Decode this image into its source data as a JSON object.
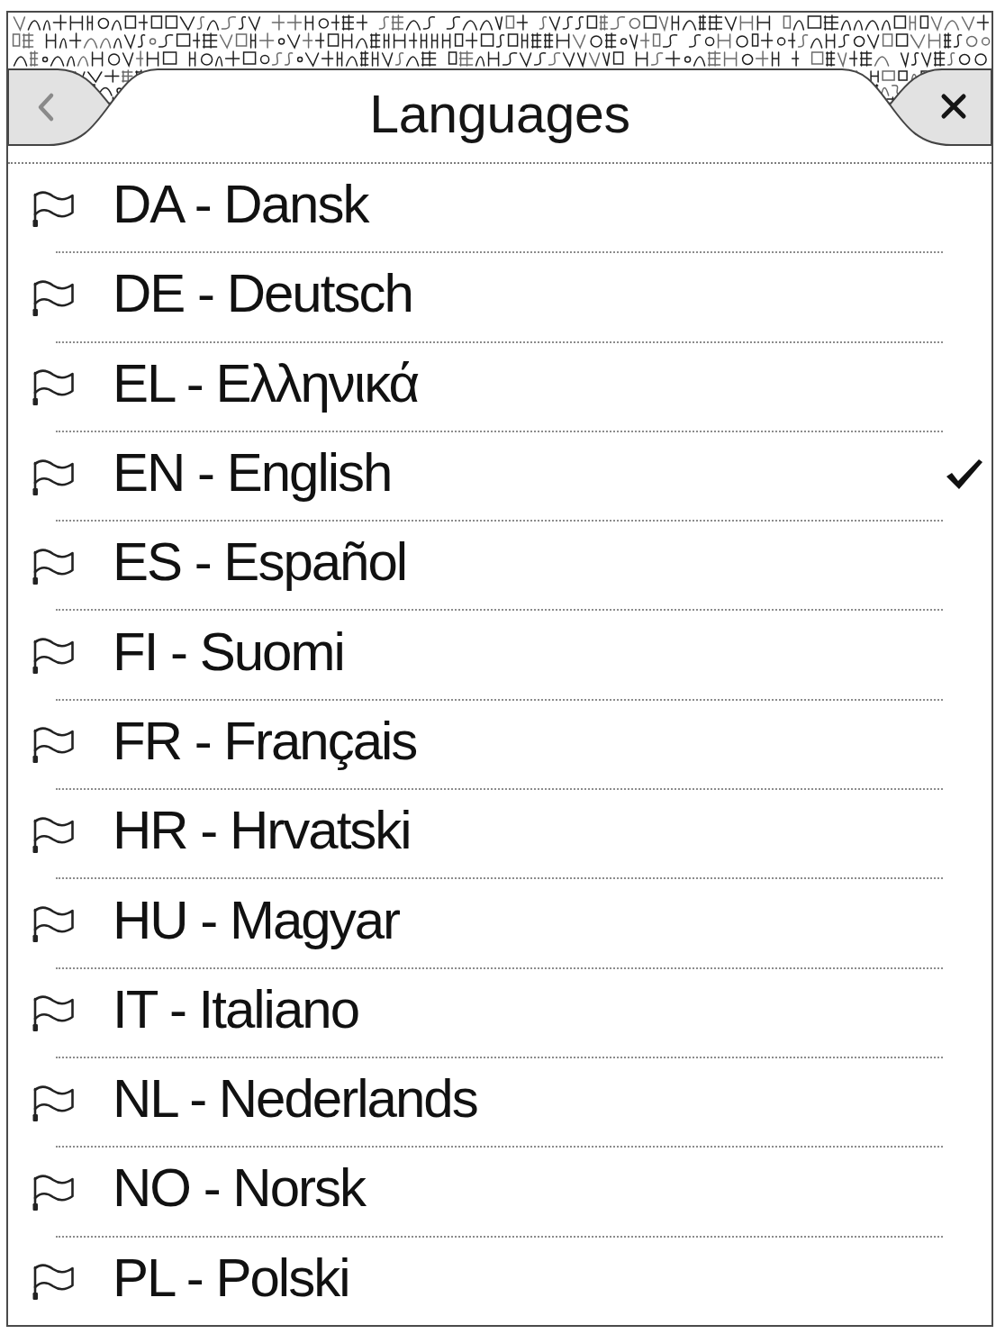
{
  "header": {
    "title": "Languages"
  },
  "languages": [
    {
      "label": "DA - Dansk",
      "selected": false
    },
    {
      "label": "DE - Deutsch",
      "selected": false
    },
    {
      "label": "EL - Ελληνικά",
      "selected": false
    },
    {
      "label": "EN - English",
      "selected": true
    },
    {
      "label": "ES - Español",
      "selected": false
    },
    {
      "label": "FI - Suomi",
      "selected": false
    },
    {
      "label": "FR - Français",
      "selected": false
    },
    {
      "label": "HR - Hrvatski",
      "selected": false
    },
    {
      "label": "HU - Magyar",
      "selected": false
    },
    {
      "label": "IT - Italiano",
      "selected": false
    },
    {
      "label": "NL - Nederlands",
      "selected": false
    },
    {
      "label": "NO - Norsk",
      "selected": false
    },
    {
      "label": "PL - Polski",
      "selected": false
    }
  ]
}
